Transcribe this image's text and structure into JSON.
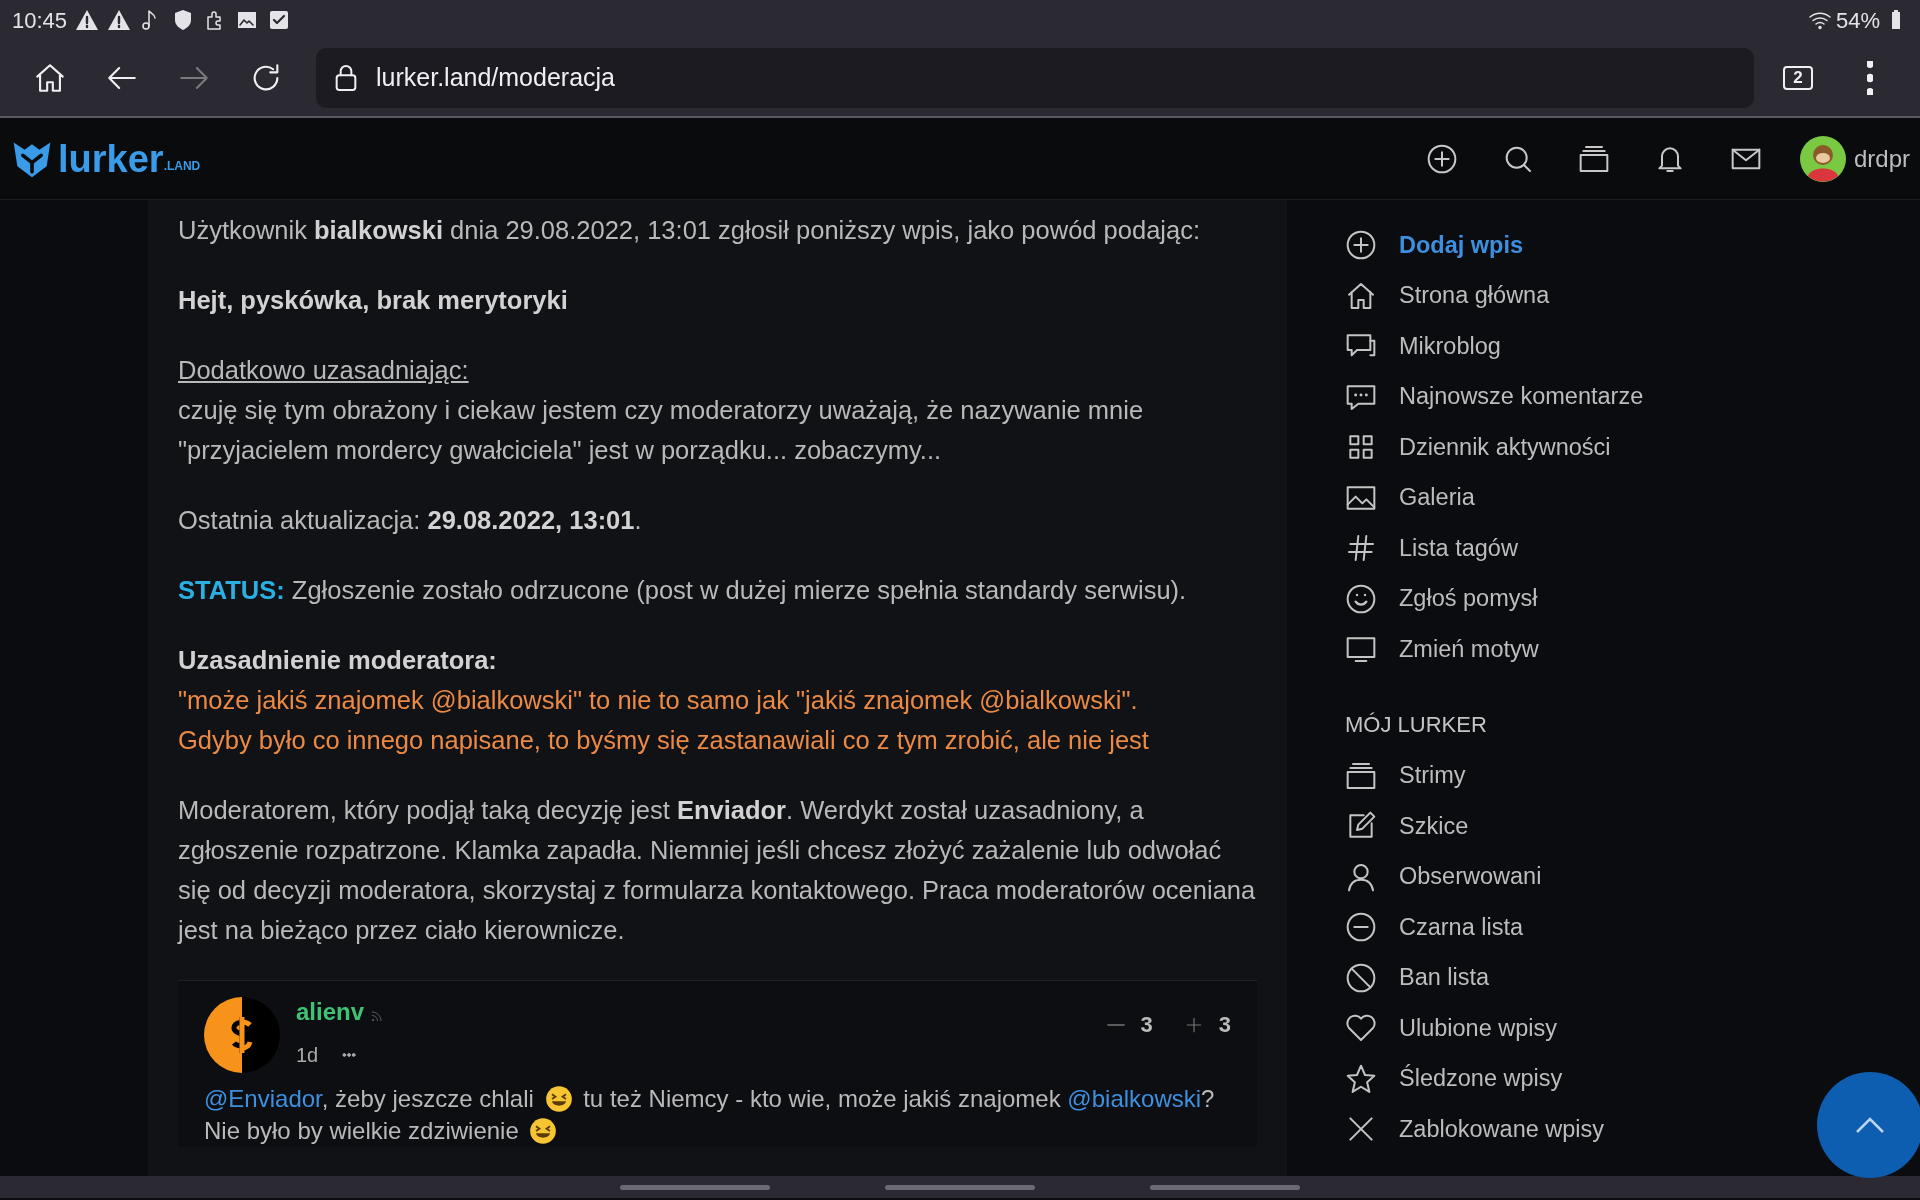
{
  "status_bar": {
    "time": "10:45",
    "battery": "54%"
  },
  "browser": {
    "url": "lurker.land/moderacja",
    "tab_count": "2",
    "forward_disabled": true
  },
  "site_header": {
    "logo": "lurker",
    "logo_suffix": ".LAND",
    "username": "drdpr"
  },
  "report": {
    "intro": "Użytkownik **bialkowski** dnia 29.08.2022, 13:01 zgłosił poniższy wpis, jako powód podając:",
    "reason": "Hejt, pyskówka, brak merytoryki",
    "details_label": "Dodatkowo uzasadniając:",
    "details_text": "czuję się tym obrażony i ciekaw jestem czy moderatorzy uważają, że nazywanie mnie \"przyjacielem mordercy gwałciciela\" jest w porządku... zobaczymy...",
    "last_update": "Ostatnia aktualizacja: **29.08.2022, 13:01**.",
    "status_label": "STATUS:",
    "status_text": "Zgłoszenie zostało odrzucone (post w dużej mierze spełnia standardy serwisu).",
    "moderator_label": "Uzasadnienie moderatora:",
    "moderator_lines": [
      "\"może jakiś znajomek @bialkowski\" to nie to samo jak \"jakiś znajomek @bialkowski\".",
      "Gdyby było co innego napisane, to byśmy się zastanawiali co z tym zrobić, ale nie jest"
    ],
    "closing": "Moderatorem, który podjął taką decyzję jest **Enviador**. Werdykt został uzasadniony, a zgłoszenie rozpatrzone. Klamka zapadła. Niemniej jeśli chcesz złożyć zażalenie lub odwołać się od decyzji moderatora, skorzystaj z formularza kontaktowego. Praca moderatorów oceniana jest na bieżąco przez ciało kierownicze."
  },
  "comment": {
    "author": "alienv",
    "time": "1d",
    "votes_down": "3",
    "votes_up": "3",
    "segments": [
      {
        "kind": "mention",
        "text": "@Enviador"
      },
      {
        "kind": "text",
        "text": ", żeby jeszcze chlali"
      },
      {
        "kind": "emoji"
      },
      {
        "kind": "text",
        "text": "tu też Niemcy - kto wie, może jakiś znajomek"
      },
      {
        "kind": "mention",
        "text": "@bialkowski"
      },
      {
        "kind": "text",
        "text": "? Nie było by wielkie zdziwienie"
      },
      {
        "kind": "emoji"
      }
    ]
  },
  "sidebar": {
    "sections": [
      {
        "items": [
          {
            "label": "Dodaj wpis",
            "selected": true
          },
          {
            "label": "Strona główna",
            "selected": false
          },
          {
            "label": "Mikroblog",
            "selected": false
          },
          {
            "label": "Najnowsze komentarze",
            "selected": false
          },
          {
            "label": "Dziennik aktywności",
            "selected": false
          },
          {
            "label": "Galeria",
            "selected": false
          },
          {
            "label": "Lista tagów",
            "selected": false
          },
          {
            "label": "Zgłoś pomysł",
            "selected": false
          },
          {
            "label": "Zmień motyw",
            "selected": false
          }
        ]
      },
      {
        "title": "MÓJ LURKER",
        "items": [
          {
            "label": "Strimy",
            "selected": false
          },
          {
            "label": "Szkice",
            "selected": false
          },
          {
            "label": "Obserwowani",
            "selected": false
          },
          {
            "label": "Czarna lista",
            "selected": false
          },
          {
            "label": "Ban lista",
            "selected": false
          },
          {
            "label": "Ulubione wpisy",
            "selected": false
          },
          {
            "label": "Śledzone wpisy",
            "selected": false
          },
          {
            "label": "Zablokowane wpisy",
            "selected": false
          }
        ]
      }
    ]
  }
}
